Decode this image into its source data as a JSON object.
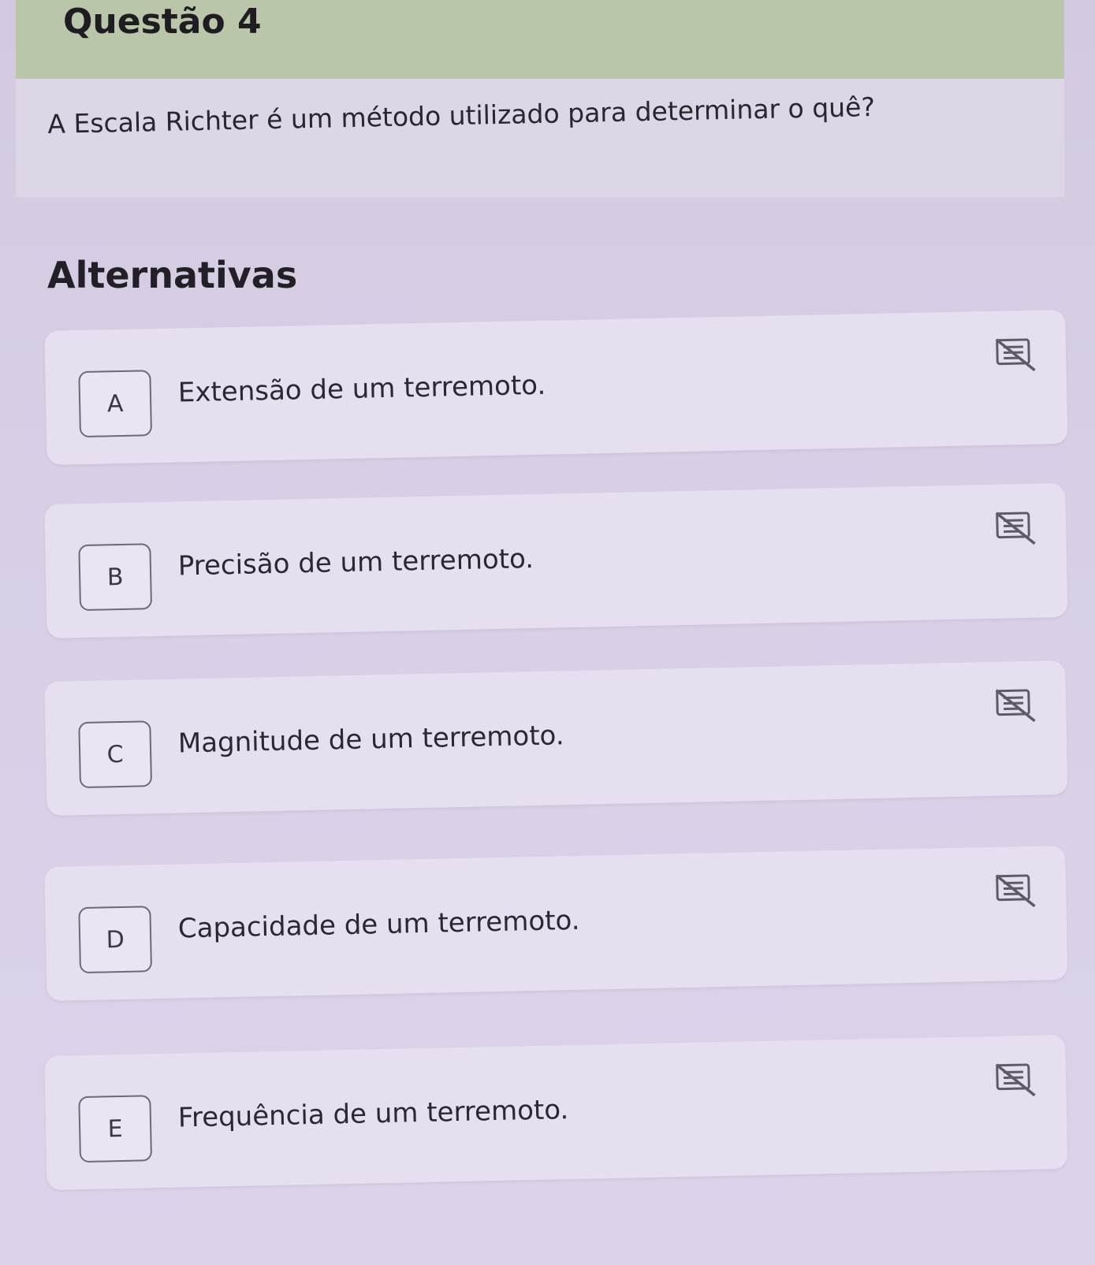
{
  "question": {
    "title": "Questão 4",
    "text": "A Escala Richter é um método utilizado para determinar o quê?"
  },
  "alternatives": {
    "title": "Alternativas",
    "items": [
      {
        "letter": "A",
        "text": "Extensão de um terremoto."
      },
      {
        "letter": "B",
        "text": "Precisão de um terremoto."
      },
      {
        "letter": "C",
        "text": "Magnitude de um terremoto."
      },
      {
        "letter": "D",
        "text": "Capacidade de um terremoto."
      },
      {
        "letter": "E",
        "text": "Frequência de um terremoto."
      }
    ]
  },
  "icons": {
    "eliminate": "strikethrough-eliminate-icon"
  },
  "colors": {
    "header_band": "#b9c6aa",
    "card": "#e6dff0",
    "background": "#d3cae0"
  }
}
